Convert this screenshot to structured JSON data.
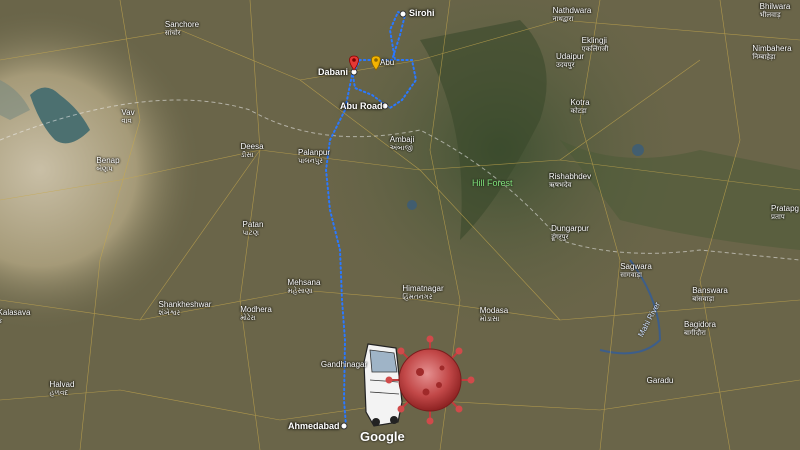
{
  "map": {
    "brand": "Google",
    "region_label": "Hill Forest",
    "river_label": "Mahi River",
    "route_points": {
      "start": "Ahmedabad",
      "via": [
        "Gandhinagar",
        "Palanpur",
        "Abu Road"
      ],
      "end": "Sirohi"
    },
    "route_labels": [
      {
        "name": "Sirohi"
      },
      {
        "name": "Dabani"
      },
      {
        "name": "Abu Road"
      },
      {
        "name": "Ahmedabad"
      },
      {
        "name": "Abu"
      }
    ],
    "places": [
      {
        "name": "Sanchore",
        "local": "सांचोर"
      },
      {
        "name": "Vav",
        "local": "વાવ"
      },
      {
        "name": "Benap",
        "local": "બેણપ"
      },
      {
        "name": "Deesa",
        "local": "ડીસા"
      },
      {
        "name": "Palanpur",
        "local": "પાલનપુર"
      },
      {
        "name": "Ambaji",
        "local": "અંબાજી"
      },
      {
        "name": "Patan",
        "local": "પાટણ"
      },
      {
        "name": "Mehsana",
        "local": "મહેસાણા"
      },
      {
        "name": "Modhera",
        "local": "મોઢેરા"
      },
      {
        "name": "Shankheshwar",
        "local": "શંખેશ્વર"
      },
      {
        "name": "Himatnagar",
        "local": "હિંમતનગર"
      },
      {
        "name": "Modasa",
        "local": "મોડાસા"
      },
      {
        "name": "Gandhinagar",
        "local": ""
      },
      {
        "name": "Halvad",
        "local": "હળવદ"
      },
      {
        "name": "Kalasava",
        "local": "ક"
      },
      {
        "name": "Nathdwara",
        "local": "नाथद्वारा"
      },
      {
        "name": "Udaipur",
        "local": "उदयपुर"
      },
      {
        "name": "Eklingji",
        "local": "एकलिंगजी"
      },
      {
        "name": "Kotra",
        "local": "कोटड़ा"
      },
      {
        "name": "Rishabhdev",
        "local": "ऋषभदेव"
      },
      {
        "name": "Dungarpur",
        "local": "डूंगरपुर"
      },
      {
        "name": "Sagwara",
        "local": "सागवाड़ा"
      },
      {
        "name": "Banswara",
        "local": "बांसवाड़ा"
      },
      {
        "name": "Bagidora",
        "local": "बागीदौरा"
      },
      {
        "name": "Nimbahera",
        "local": "निम्बाहेड़ा"
      },
      {
        "name": "Pratapg",
        "local": "प्रताप"
      },
      {
        "name": "Bhilwara",
        "local": "भीलवाड़"
      },
      {
        "name": "Garadu",
        "local": ""
      }
    ]
  }
}
